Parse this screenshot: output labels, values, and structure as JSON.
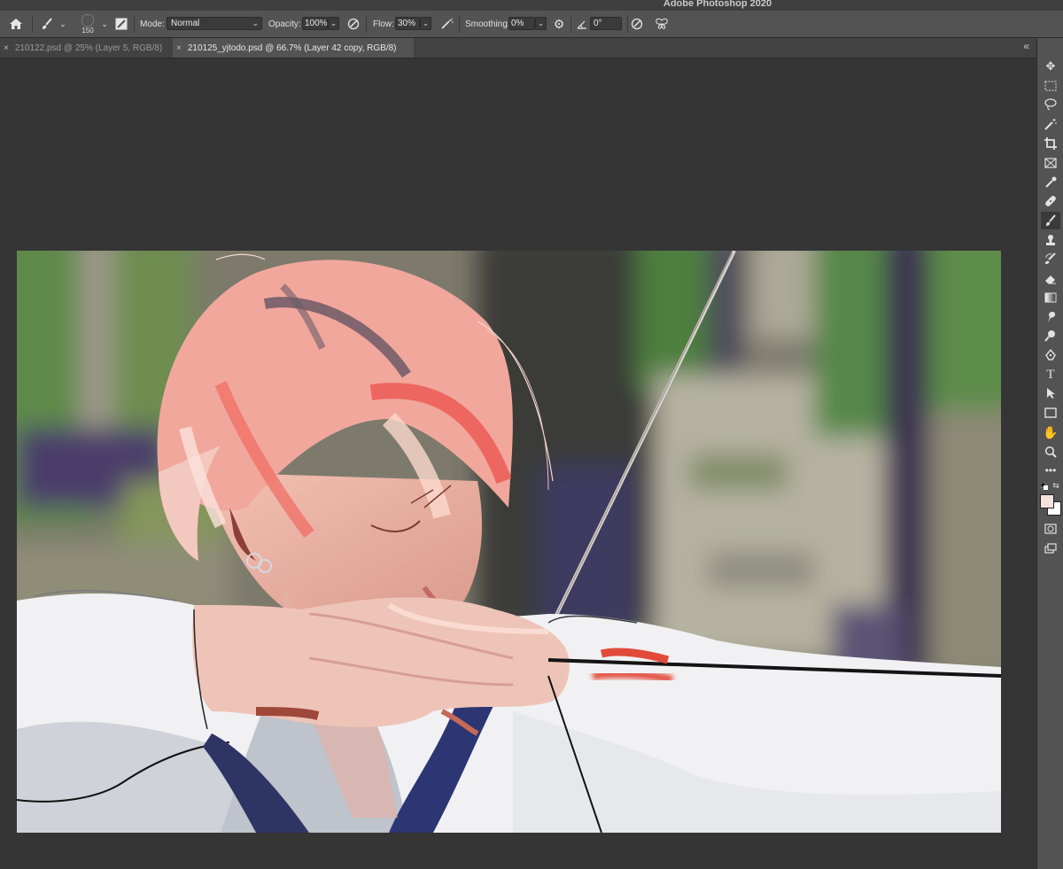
{
  "app": {
    "title": "Adobe Photoshop 2020"
  },
  "options_bar": {
    "brush_size": "150",
    "mode_label": "Mode:",
    "mode_value": "Normal",
    "opacity_label": "Opacity:",
    "opacity_value": "100%",
    "flow_label": "Flow:",
    "flow_value": "30%",
    "smoothing_label": "Smoothing:",
    "smoothing_value": "0%",
    "angle_value": "0°"
  },
  "tabs": [
    {
      "label": "210122.psd @ 25% (Layer 5, RGB/8)",
      "active": false
    },
    {
      "label": "210125_yjtodo.psd @ 66.7% (Layer 42 copy, RGB/8)",
      "active": true
    }
  ],
  "tools": [
    "move-tool-icon",
    "marquee-tool-icon",
    "lasso-tool-icon",
    "magic-wand-tool-icon",
    "crop-tool-icon",
    "frame-tool-icon",
    "eyedropper-tool-icon",
    "healing-brush-tool-icon",
    "brush-tool-icon",
    "clone-stamp-tool-icon",
    "history-brush-tool-icon",
    "eraser-tool-icon",
    "gradient-tool-icon",
    "smudge-tool-icon",
    "dodge-tool-icon",
    "pen-tool-icon",
    "type-tool-icon",
    "path-selection-tool-icon",
    "rectangle-tool-icon",
    "hand-tool-icon",
    "zoom-tool-icon",
    "more-tools-icon"
  ],
  "colors": {
    "foreground": "#f7e1dd",
    "background": "#ffffff",
    "canvas_bg": "#353535"
  }
}
